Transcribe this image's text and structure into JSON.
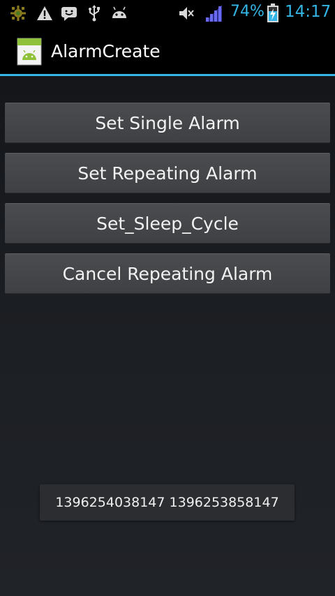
{
  "status_bar": {
    "icons_left": [
      "sun-icon",
      "warning-icon",
      "messenger-icon",
      "usb-icon",
      "android-debug-icon"
    ],
    "icons_right": [
      "mute-icon",
      "signal-icon",
      "battery-charging-icon"
    ],
    "battery_percent": "74%",
    "time": "14:17",
    "accent_color": "#33b5e5"
  },
  "action_bar": {
    "app_title": "AlarmCreate",
    "app_icon": "android-app-icon"
  },
  "buttons": {
    "single": "Set Single Alarm",
    "repeating": "Set Repeating Alarm",
    "sleep": "Set_Sleep_Cycle",
    "cancel": "Cancel Repeating Alarm"
  },
  "toast": {
    "text": "1396254038147 1396253858147"
  }
}
